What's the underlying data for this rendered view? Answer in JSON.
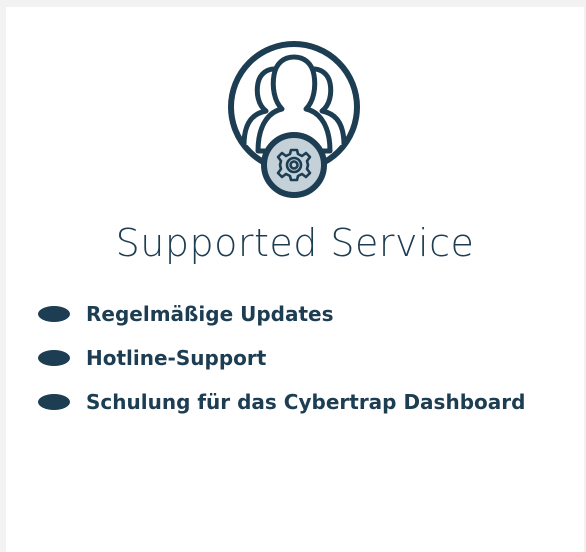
{
  "card": {
    "icon": "users-gear-icon",
    "title": "Supported Service",
    "items": [
      {
        "label": "Regelmäßige Updates"
      },
      {
        "label": "Hotline-Support"
      },
      {
        "label": "Schulung für das Cybertrap Dashboard"
      }
    ]
  },
  "colors": {
    "primary": "#1d3d52",
    "icon_fill": "#c5d1d9",
    "background": "#ffffff"
  }
}
